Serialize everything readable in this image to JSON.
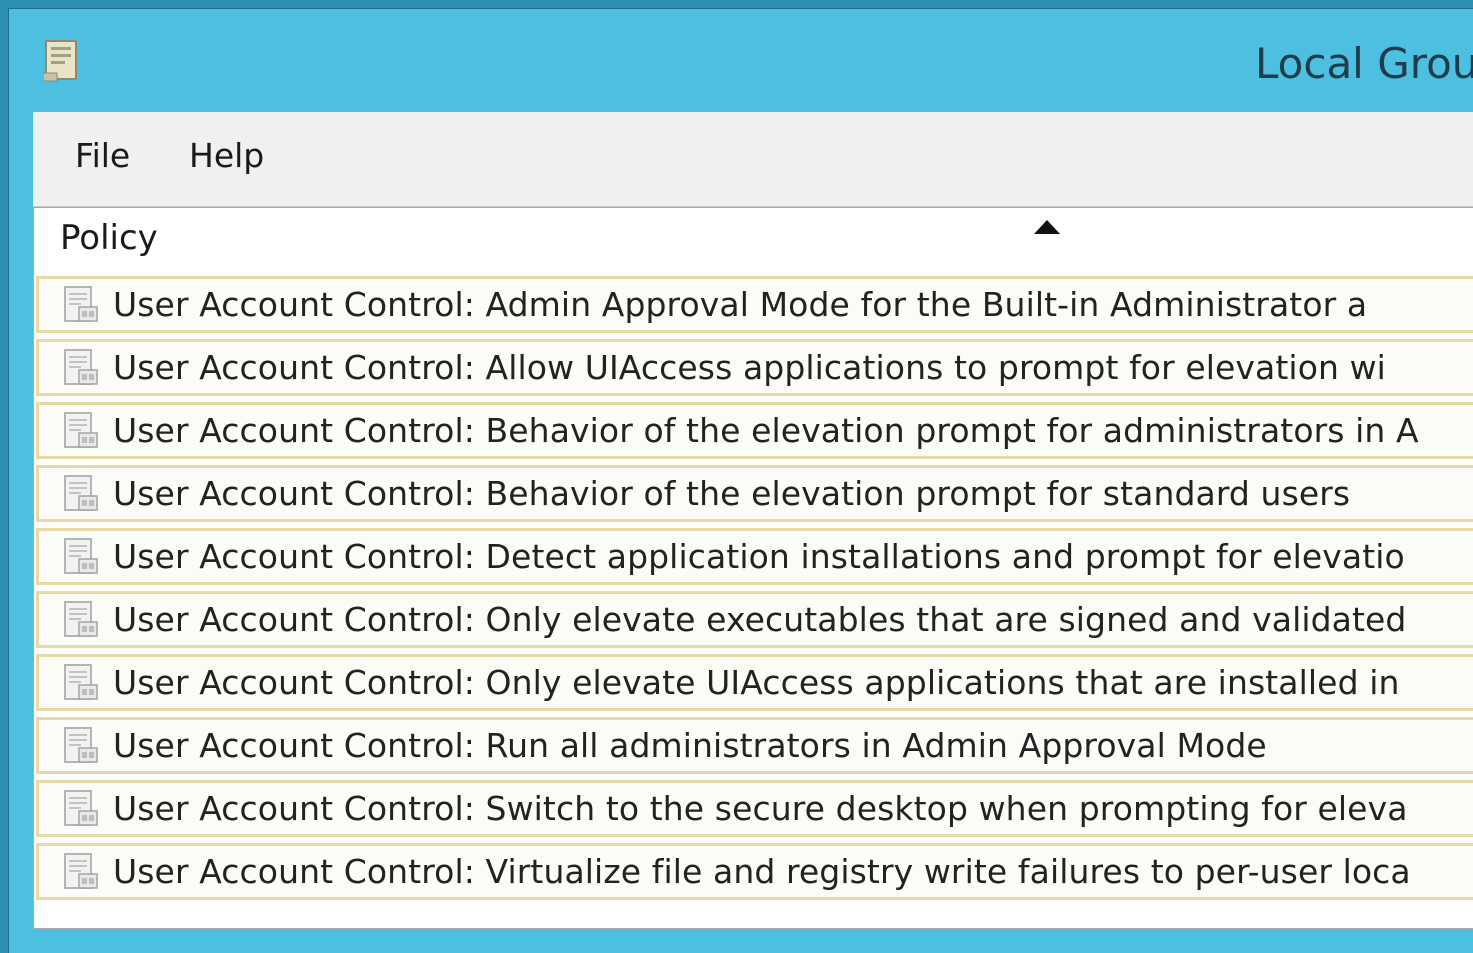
{
  "window": {
    "title": "Local Grou",
    "icon": "policy-document-icon"
  },
  "menu": {
    "file": "File",
    "help": "Help"
  },
  "list": {
    "column_header": "Policy",
    "sort_indicator": "sort-ascending-icon",
    "row_icon": "policy-setting-icon",
    "rows": [
      "User Account Control: Admin Approval Mode for the Built-in Administrator a",
      "User Account Control: Allow UIAccess applications to prompt for elevation wi",
      "User Account Control: Behavior of the elevation prompt for administrators in A",
      "User Account Control: Behavior of the elevation prompt for standard users",
      "User Account Control: Detect application installations and prompt for elevatio",
      "User Account Control: Only elevate executables that are signed and validated",
      "User Account Control: Only elevate UIAccess applications that are installed in",
      "User Account Control: Run all administrators in Admin Approval Mode",
      "User Account Control: Switch to the secure desktop when prompting for eleva",
      "User Account Control: Virtualize file and registry write failures to per-user loca"
    ]
  },
  "colors": {
    "window_frame": "#4dbfe0",
    "row_border": "#e6d9a4",
    "menubar": "#f0f0f0"
  }
}
